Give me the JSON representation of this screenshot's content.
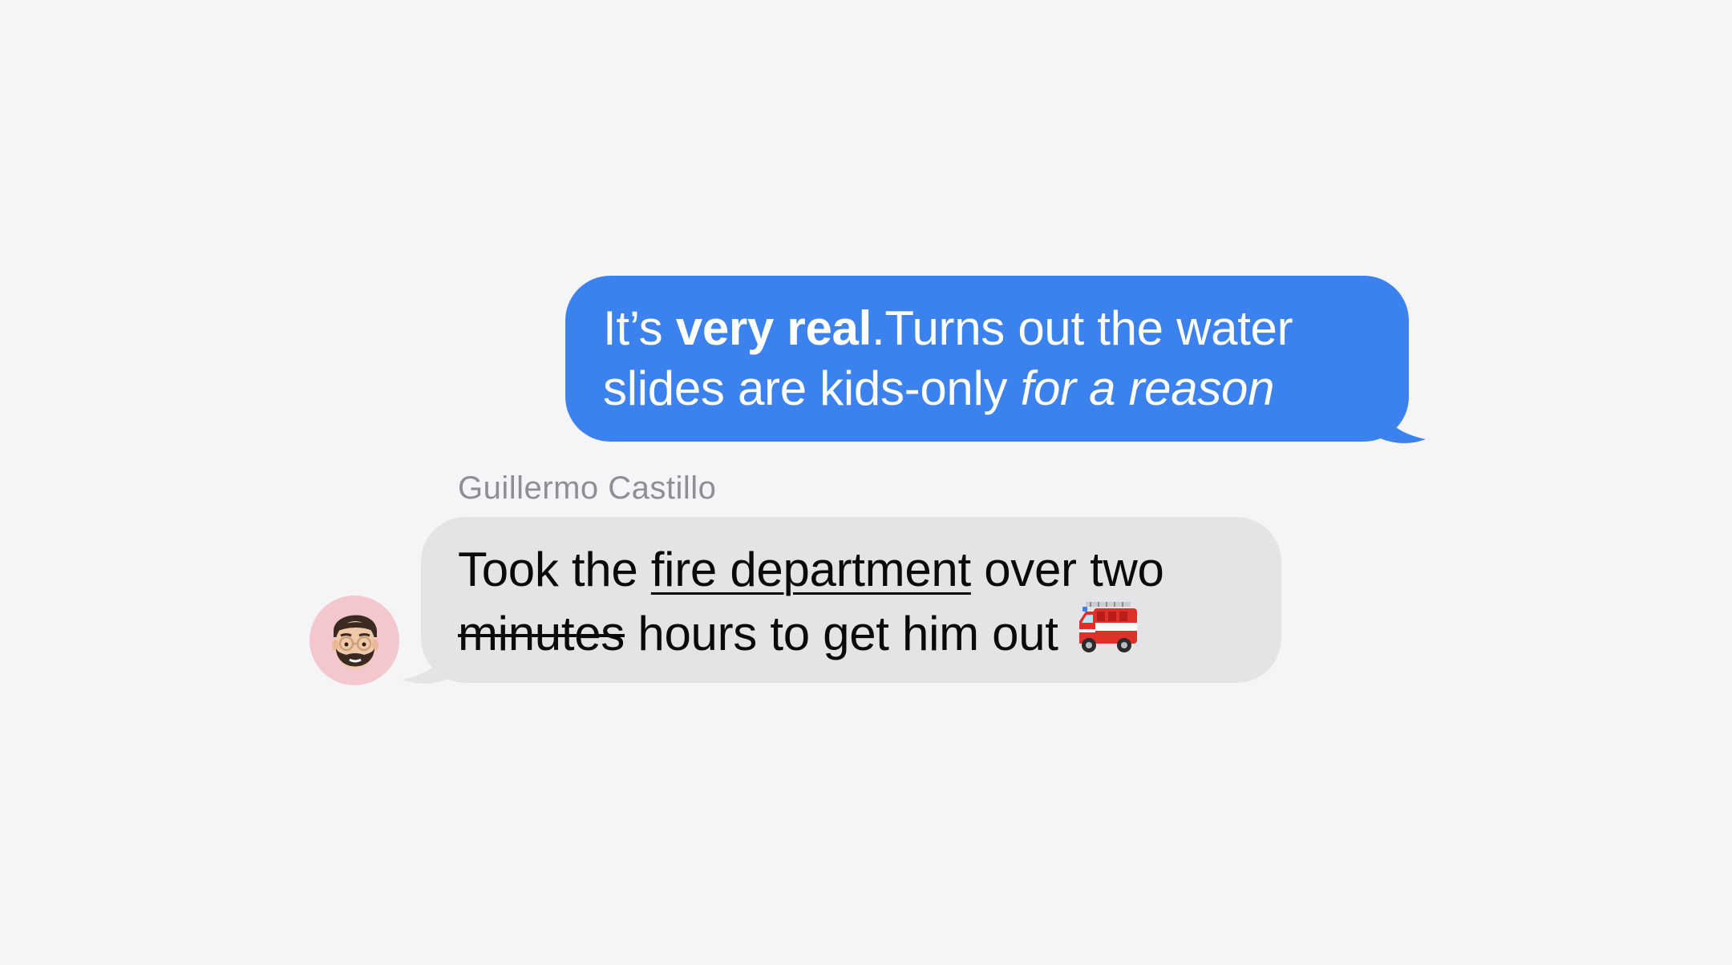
{
  "conversation": {
    "outgoing": {
      "part1": "It’s ",
      "part2_bold": "very real",
      "part3": ".Turns out the water slides are kids-only ",
      "part4_italic": "for a reason"
    },
    "incoming": {
      "sender_name": "Guillermo Castillo",
      "part1": "Took the ",
      "part2_underline": "fire department",
      "part3": " over two ",
      "part4_strike": "minutes",
      "part5": " hours to get him out",
      "emoji_icon": "fire-engine-icon"
    }
  },
  "colors": {
    "background": "#f5f5f7",
    "outgoing_bubble": "#3b82ee",
    "incoming_bubble": "#e4e4e6",
    "avatar_bg": "#f4c7cf",
    "sender_name": "#8e8e93"
  },
  "avatar": {
    "icon": "memoji-avatar-icon"
  }
}
